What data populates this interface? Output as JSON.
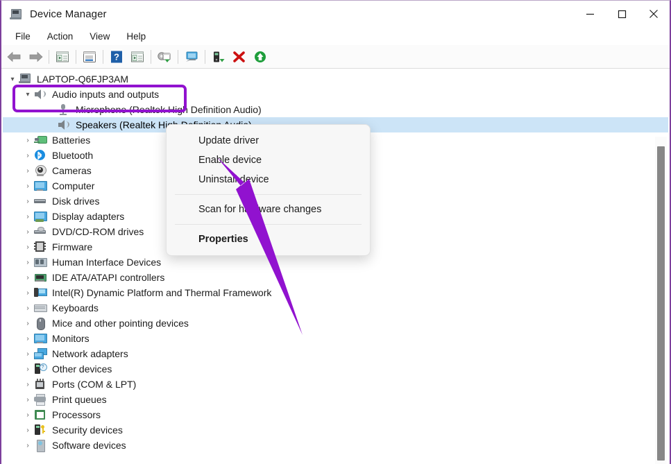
{
  "window": {
    "title": "Device Manager",
    "icon": "device-manager-icon",
    "controls": {
      "minimize": "minimize-icon",
      "maximize": "maximize-icon",
      "close": "close-icon"
    }
  },
  "menubar": {
    "items": [
      {
        "label": "File"
      },
      {
        "label": "Action"
      },
      {
        "label": "View"
      },
      {
        "label": "Help"
      }
    ]
  },
  "toolbar": {
    "buttons": [
      {
        "name": "back-arrow-icon"
      },
      {
        "name": "forward-arrow-icon"
      },
      {
        "name": "show-hide-console-tree-icon"
      },
      {
        "name": "properties-icon"
      },
      {
        "name": "help-icon"
      },
      {
        "name": "update-driver-icon"
      },
      {
        "name": "scan-for-hardware-changes-icon"
      },
      {
        "name": "display-icon"
      },
      {
        "name": "add-legacy-hardware-icon"
      },
      {
        "name": "uninstall-device-icon"
      },
      {
        "name": "enable-device-icon"
      }
    ]
  },
  "tree": {
    "root": {
      "label": "LAPTOP-Q6FJP3AM",
      "icon": "computer-icon",
      "expanded": true
    },
    "nodes": [
      {
        "label": "Audio inputs and outputs",
        "icon": "speaker-icon",
        "depth": 1,
        "expanded": true,
        "highlighted": true
      },
      {
        "label": "Microphone (Realtek High Definition Audio)",
        "icon": "microphone-icon",
        "depth": 2,
        "leaf": true
      },
      {
        "label": "Speakers (Realtek High Definition Audio)",
        "icon": "speaker-icon",
        "depth": 2,
        "leaf": true,
        "selected": true
      },
      {
        "label": "Batteries",
        "icon": "battery-icon",
        "depth": 1
      },
      {
        "label": "Bluetooth",
        "icon": "bluetooth-icon",
        "depth": 1
      },
      {
        "label": "Cameras",
        "icon": "camera-icon",
        "depth": 1
      },
      {
        "label": "Computer",
        "icon": "computer-icon",
        "depth": 1
      },
      {
        "label": "Disk drives",
        "icon": "disk-drive-icon",
        "depth": 1
      },
      {
        "label": "Display adapters",
        "icon": "display-adapter-icon",
        "depth": 1
      },
      {
        "label": "DVD/CD-ROM drives",
        "icon": "dvd-drive-icon",
        "depth": 1
      },
      {
        "label": "Firmware",
        "icon": "firmware-icon",
        "depth": 1
      },
      {
        "label": "Human Interface Devices",
        "icon": "hid-icon",
        "depth": 1
      },
      {
        "label": "IDE ATA/ATAPI controllers",
        "icon": "ide-controller-icon",
        "depth": 1
      },
      {
        "label": "Intel(R) Dynamic Platform and Thermal Framework",
        "icon": "thermal-framework-icon",
        "depth": 1
      },
      {
        "label": "Keyboards",
        "icon": "keyboard-icon",
        "depth": 1
      },
      {
        "label": "Mice and other pointing devices",
        "icon": "mouse-icon",
        "depth": 1
      },
      {
        "label": "Monitors",
        "icon": "monitor-icon",
        "depth": 1
      },
      {
        "label": "Network adapters",
        "icon": "network-adapter-icon",
        "depth": 1
      },
      {
        "label": "Other devices",
        "icon": "other-device-icon",
        "depth": 1
      },
      {
        "label": "Ports (COM & LPT)",
        "icon": "port-icon",
        "depth": 1
      },
      {
        "label": "Print queues",
        "icon": "printer-icon",
        "depth": 1
      },
      {
        "label": "Processors",
        "icon": "processor-icon",
        "depth": 1
      },
      {
        "label": "Security devices",
        "icon": "security-device-icon",
        "depth": 1
      },
      {
        "label": "Software devices",
        "icon": "software-device-icon",
        "depth": 1
      }
    ]
  },
  "context_menu": {
    "items": [
      {
        "label": "Update driver",
        "bold": false
      },
      {
        "label": "Enable device",
        "bold": false
      },
      {
        "label": "Uninstall device",
        "bold": false
      },
      {
        "separator": true
      },
      {
        "label": "Scan for hardware changes",
        "bold": false
      },
      {
        "separator": true
      },
      {
        "label": "Properties",
        "bold": true
      }
    ]
  },
  "annotations": {
    "accent_color": "#9112cf",
    "highlight_box_target": "Audio inputs and outputs",
    "arrow_points_to": "Enable device"
  },
  "colors": {
    "window_border": "#7d3f9c",
    "selection": "#cce4f7",
    "text": "#1b1b1b"
  }
}
